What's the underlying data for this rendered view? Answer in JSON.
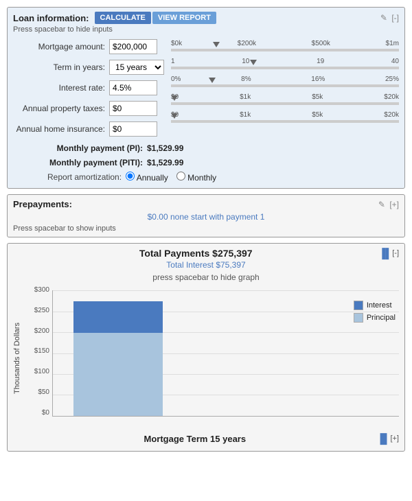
{
  "loan_section": {
    "title": "Loan information:",
    "btn_calculate": "CALCULATE",
    "btn_view_report": "VIEW REPORT",
    "spacebar_hint": "Press spacebar to hide inputs",
    "pencil_icon": "✎",
    "bracket_label": "[-]",
    "fields": [
      {
        "label": "Mortgage amount:",
        "value": "$200,000",
        "id": "mortgage"
      },
      {
        "label": "Term in years:",
        "value": "15 years",
        "id": "term"
      },
      {
        "label": "Interest rate:",
        "value": "4.5%",
        "id": "interest"
      },
      {
        "label": "Annual property taxes:",
        "value": "$0",
        "id": "taxes"
      },
      {
        "label": "Annual home insurance:",
        "value": "$0",
        "id": "insurance"
      }
    ],
    "sliders": [
      {
        "labels": [
          "$0k",
          "$200k",
          "$500k",
          "$1m"
        ],
        "marker_pct": 20
      },
      {
        "labels": [
          "1",
          "10",
          "19",
          "40"
        ],
        "marker_pct": 36
      },
      {
        "labels": [
          "0%",
          "8%",
          "16%",
          "25%"
        ],
        "marker_pct": 18
      },
      {
        "labels": [
          "$0",
          "$1k",
          "$5k",
          "$20k"
        ],
        "marker_pct": 0
      },
      {
        "labels": [
          "$0",
          "$1k",
          "$5k",
          "$20k"
        ],
        "marker_pct": 0
      }
    ],
    "monthly_pi_label": "Monthly payment (PI):",
    "monthly_pi_value": "$1,529.99",
    "monthly_piti_label": "Monthly payment (PITI):",
    "monthly_piti_value": "$1,529.99",
    "amort_label": "Report amortization:",
    "amort_annually": "Annually",
    "amort_monthly": "Monthly"
  },
  "prepay_section": {
    "title": "Prepayments:",
    "pencil_icon": "✎",
    "bracket_label": "[+]",
    "info_text": "$0.00 none start with payment 1",
    "spacebar_hint": "Press spacebar to show inputs"
  },
  "totals_section": {
    "title": "Total Payments $275,397",
    "interest_label": "Total Interest $75,397",
    "chart_icon": "▐▌",
    "bracket_label": "[-]"
  },
  "graph_section": {
    "title": "press spacebar to hide graph",
    "y_axis_label": "Thousands of Dollars",
    "y_ticks": [
      "$300",
      "$250",
      "$200",
      "$150",
      "$100",
      "$50",
      "$0"
    ],
    "bar_interest_pct": 27,
    "bar_principal_pct": 73,
    "legend_interest": "Interest",
    "legend_principal": "Principal",
    "x_label": "",
    "footer_title": "Mortgage Term 15 years",
    "footer_icon": "▐▌",
    "footer_bracket": "[+]",
    "total_height_pct": 91,
    "interest_height_pct": 25,
    "principal_height_pct": 66
  }
}
